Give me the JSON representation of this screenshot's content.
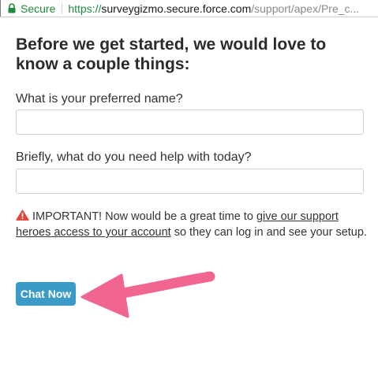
{
  "browser": {
    "secure_label": "Secure",
    "url_scheme": "https://",
    "url_host": "surveygizmo.secure.force.com",
    "url_path": "/support/apex/Pre_c...",
    "lock_icon": "lock-icon"
  },
  "form": {
    "heading": "Before we get started, we would love to know a couple things:",
    "name_label": "What is your preferred name?",
    "name_value": "",
    "help_label": "Briefly, what do you need help with today?",
    "help_value": ""
  },
  "notice": {
    "icon": "warning-icon",
    "icon_color": "#e0453a",
    "prefix": "IMPORTANT! Now would be a great time to ",
    "link_text": "give our support heroes access to your account",
    "suffix": " so they can log in and see your setup."
  },
  "actions": {
    "chat_label": "Chat Now",
    "chat_color": "#3a9bc6"
  },
  "annotation": {
    "arrow_icon": "arrow-left-icon",
    "arrow_color": "#f06690"
  }
}
